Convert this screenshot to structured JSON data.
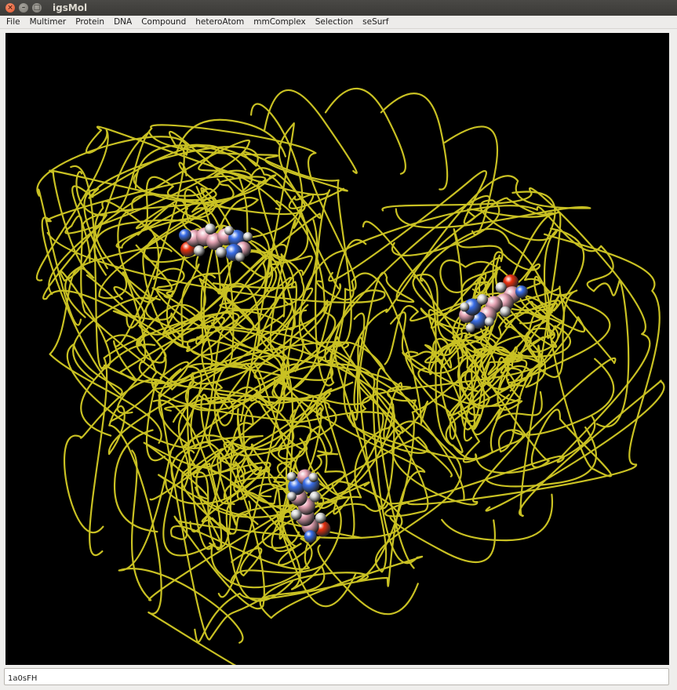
{
  "window": {
    "title": "igsMol",
    "controls": [
      "close-icon",
      "minimize-icon",
      "maximize-icon"
    ]
  },
  "menu": {
    "items": [
      "File",
      "Multimer",
      "Protein",
      "DNA",
      "Compound",
      "heteroAtom",
      "mmComplex",
      "Selection",
      "seSurf"
    ]
  },
  "viewer": {
    "background_color": "#000000",
    "ribbon_color": "#c9c123",
    "atom_colors": {
      "carbon": "#e8a6b6",
      "nitrogen": "#3a6ee8",
      "oxygen": "#e8300f",
      "hydrogen": "#d8d8d8"
    }
  },
  "command": {
    "value": "1a0sFH"
  }
}
